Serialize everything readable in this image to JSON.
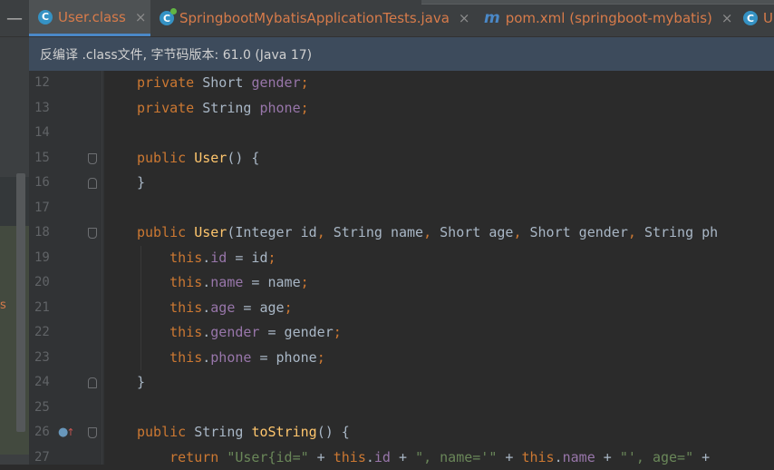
{
  "tabs": [
    {
      "label": "User.class",
      "icon": "class-file-icon",
      "active": true
    },
    {
      "label": "SpringbootMybatisApplicationTests.java",
      "icon": "java-test-class-icon"
    },
    {
      "label": "pom.xml (springboot-mybatis)",
      "icon": "maven-icon"
    },
    {
      "label": "U",
      "icon": "class-file-icon"
    }
  ],
  "notice": "反编译 .class文件, 字节码版本: 61.0 (Java 17)",
  "line_numbers": [
    "12",
    "13",
    "14",
    "15",
    "16",
    "17",
    "18",
    "19",
    "20",
    "21",
    "22",
    "23",
    "24",
    "25",
    "26",
    "27"
  ],
  "code_lines": [
    [
      {
        "t": "private ",
        "c": "kw"
      },
      {
        "t": "Short ",
        "c": "plain"
      },
      {
        "t": "gender",
        "c": "fld"
      },
      {
        "t": ";",
        "c": "punc"
      }
    ],
    [
      {
        "t": "private ",
        "c": "kw"
      },
      {
        "t": "String ",
        "c": "plain"
      },
      {
        "t": "phone",
        "c": "fld"
      },
      {
        "t": ";",
        "c": "punc"
      }
    ],
    [],
    [
      {
        "t": "public ",
        "c": "kw"
      },
      {
        "t": "User",
        "c": "fn"
      },
      {
        "t": "() {",
        "c": "plain"
      }
    ],
    [
      {
        "t": "}",
        "c": "plain"
      }
    ],
    [],
    [
      {
        "t": "public ",
        "c": "kw"
      },
      {
        "t": "User",
        "c": "fn"
      },
      {
        "t": "(Integer id",
        "c": "plain"
      },
      {
        "t": ", ",
        "c": "punc"
      },
      {
        "t": "String name",
        "c": "plain"
      },
      {
        "t": ", ",
        "c": "punc"
      },
      {
        "t": "Short age",
        "c": "plain"
      },
      {
        "t": ", ",
        "c": "punc"
      },
      {
        "t": "Short gender",
        "c": "plain"
      },
      {
        "t": ", ",
        "c": "punc"
      },
      {
        "t": "String ph",
        "c": "plain"
      }
    ],
    [
      {
        "t": "    this",
        "c": "kw"
      },
      {
        "t": ".",
        "c": "plain"
      },
      {
        "t": "id",
        "c": "fld"
      },
      {
        "t": " = id",
        "c": "plain"
      },
      {
        "t": ";",
        "c": "punc"
      }
    ],
    [
      {
        "t": "    this",
        "c": "kw"
      },
      {
        "t": ".",
        "c": "plain"
      },
      {
        "t": "name",
        "c": "fld"
      },
      {
        "t": " = name",
        "c": "plain"
      },
      {
        "t": ";",
        "c": "punc"
      }
    ],
    [
      {
        "t": "    this",
        "c": "kw"
      },
      {
        "t": ".",
        "c": "plain"
      },
      {
        "t": "age",
        "c": "fld"
      },
      {
        "t": " = age",
        "c": "plain"
      },
      {
        "t": ";",
        "c": "punc"
      }
    ],
    [
      {
        "t": "    this",
        "c": "kw"
      },
      {
        "t": ".",
        "c": "plain"
      },
      {
        "t": "gender",
        "c": "fld"
      },
      {
        "t": " = gender",
        "c": "plain"
      },
      {
        "t": ";",
        "c": "punc"
      }
    ],
    [
      {
        "t": "    this",
        "c": "kw"
      },
      {
        "t": ".",
        "c": "plain"
      },
      {
        "t": "phone",
        "c": "fld"
      },
      {
        "t": " = phone",
        "c": "plain"
      },
      {
        "t": ";",
        "c": "punc"
      }
    ],
    [
      {
        "t": "}",
        "c": "plain"
      }
    ],
    [],
    [
      {
        "t": "public ",
        "c": "kw"
      },
      {
        "t": "String ",
        "c": "plain"
      },
      {
        "t": "toString",
        "c": "fn"
      },
      {
        "t": "() {",
        "c": "plain"
      }
    ],
    [
      {
        "t": "    return ",
        "c": "kw"
      },
      {
        "t": "\"User{id=\"",
        "c": "str"
      },
      {
        "t": " + ",
        "c": "plain"
      },
      {
        "t": "this",
        "c": "kw"
      },
      {
        "t": ".",
        "c": "plain"
      },
      {
        "t": "id",
        "c": "fld"
      },
      {
        "t": " + ",
        "c": "plain"
      },
      {
        "t": "\", name='\"",
        "c": "str"
      },
      {
        "t": " + ",
        "c": "plain"
      },
      {
        "t": "this",
        "c": "kw"
      },
      {
        "t": ".",
        "c": "plain"
      },
      {
        "t": "name",
        "c": "fld"
      },
      {
        "t": " + ",
        "c": "plain"
      },
      {
        "t": "\"', age=\"",
        "c": "str"
      },
      {
        "t": " + ",
        "c": "plain"
      }
    ]
  ],
  "left_strip_mark": "s",
  "colors": {
    "keyword": "#cc7832",
    "field": "#9876aa",
    "method": "#ffc66d",
    "string": "#6a8759",
    "text": "#a9b7c6",
    "line_number": "#606366"
  }
}
